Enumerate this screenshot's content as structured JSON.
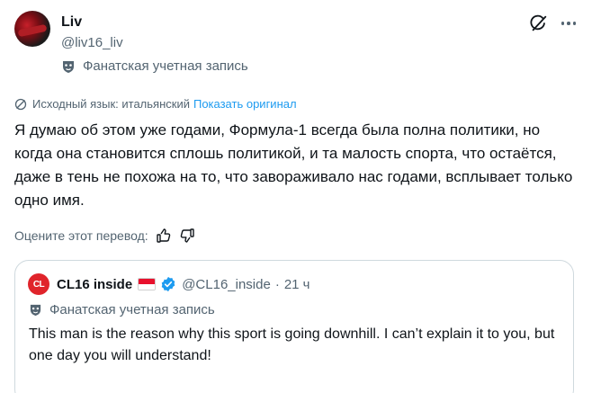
{
  "author": {
    "name": "Liv",
    "handle": "@liv16_liv",
    "fan_account_label": "Фанатская учетная запись"
  },
  "translation": {
    "source_language_label": "Исходный язык: итальянский",
    "show_original_label": "Показать оригинал"
  },
  "tweet": {
    "text": "Я думаю об этом уже годами, Формула-1 всегда была полна политики, но когда она становится сплошь политикой, и та малость спорта, что остаётся, даже в тень не похожа на то, что завораживало нас годами, всплывает только одно имя."
  },
  "rating": {
    "prompt": "Оцените этот перевод:"
  },
  "quoted_tweet": {
    "avatar_text": "CL",
    "name": "CL16 inside",
    "handle": "@CL16_inside",
    "separator": "·",
    "time": "21 ч",
    "fan_account_label": "Фанатская учетная запись",
    "text": "This man is the reason why this sport is going downhill. I can’t explain it to you, but one day you will understand!"
  },
  "icons": {
    "grok": "grok-icon",
    "more": "more-icon",
    "mask": "mask-icon",
    "globe": "globe-icon",
    "thumbs_up": "thumbs-up-icon",
    "thumbs_down": "thumbs-down-icon",
    "verified": "verified-badge-icon",
    "flag": "monaco-flag-icon"
  },
  "colors": {
    "text": "#0f1419",
    "secondary": "#536471",
    "link": "#1d9bf0",
    "border": "#cfd9de"
  }
}
